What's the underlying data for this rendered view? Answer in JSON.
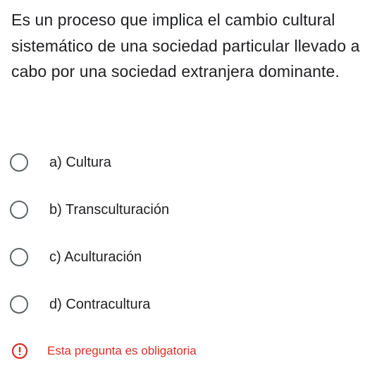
{
  "question": {
    "text": "Es un proceso que implica el cambio cultural sistemático de una sociedad particular llevado a cabo por una sociedad extranjera dominante."
  },
  "options": [
    {
      "label": "a) Cultura",
      "selected": false
    },
    {
      "label": "b) Transculturación",
      "selected": false
    },
    {
      "label": "c) Aculturación",
      "selected": false
    },
    {
      "label": "d) Contracultura",
      "selected": false
    }
  ],
  "validation": {
    "icon": "error-icon",
    "message": "Esta pregunta es obligatoria",
    "color": "#d93025"
  }
}
